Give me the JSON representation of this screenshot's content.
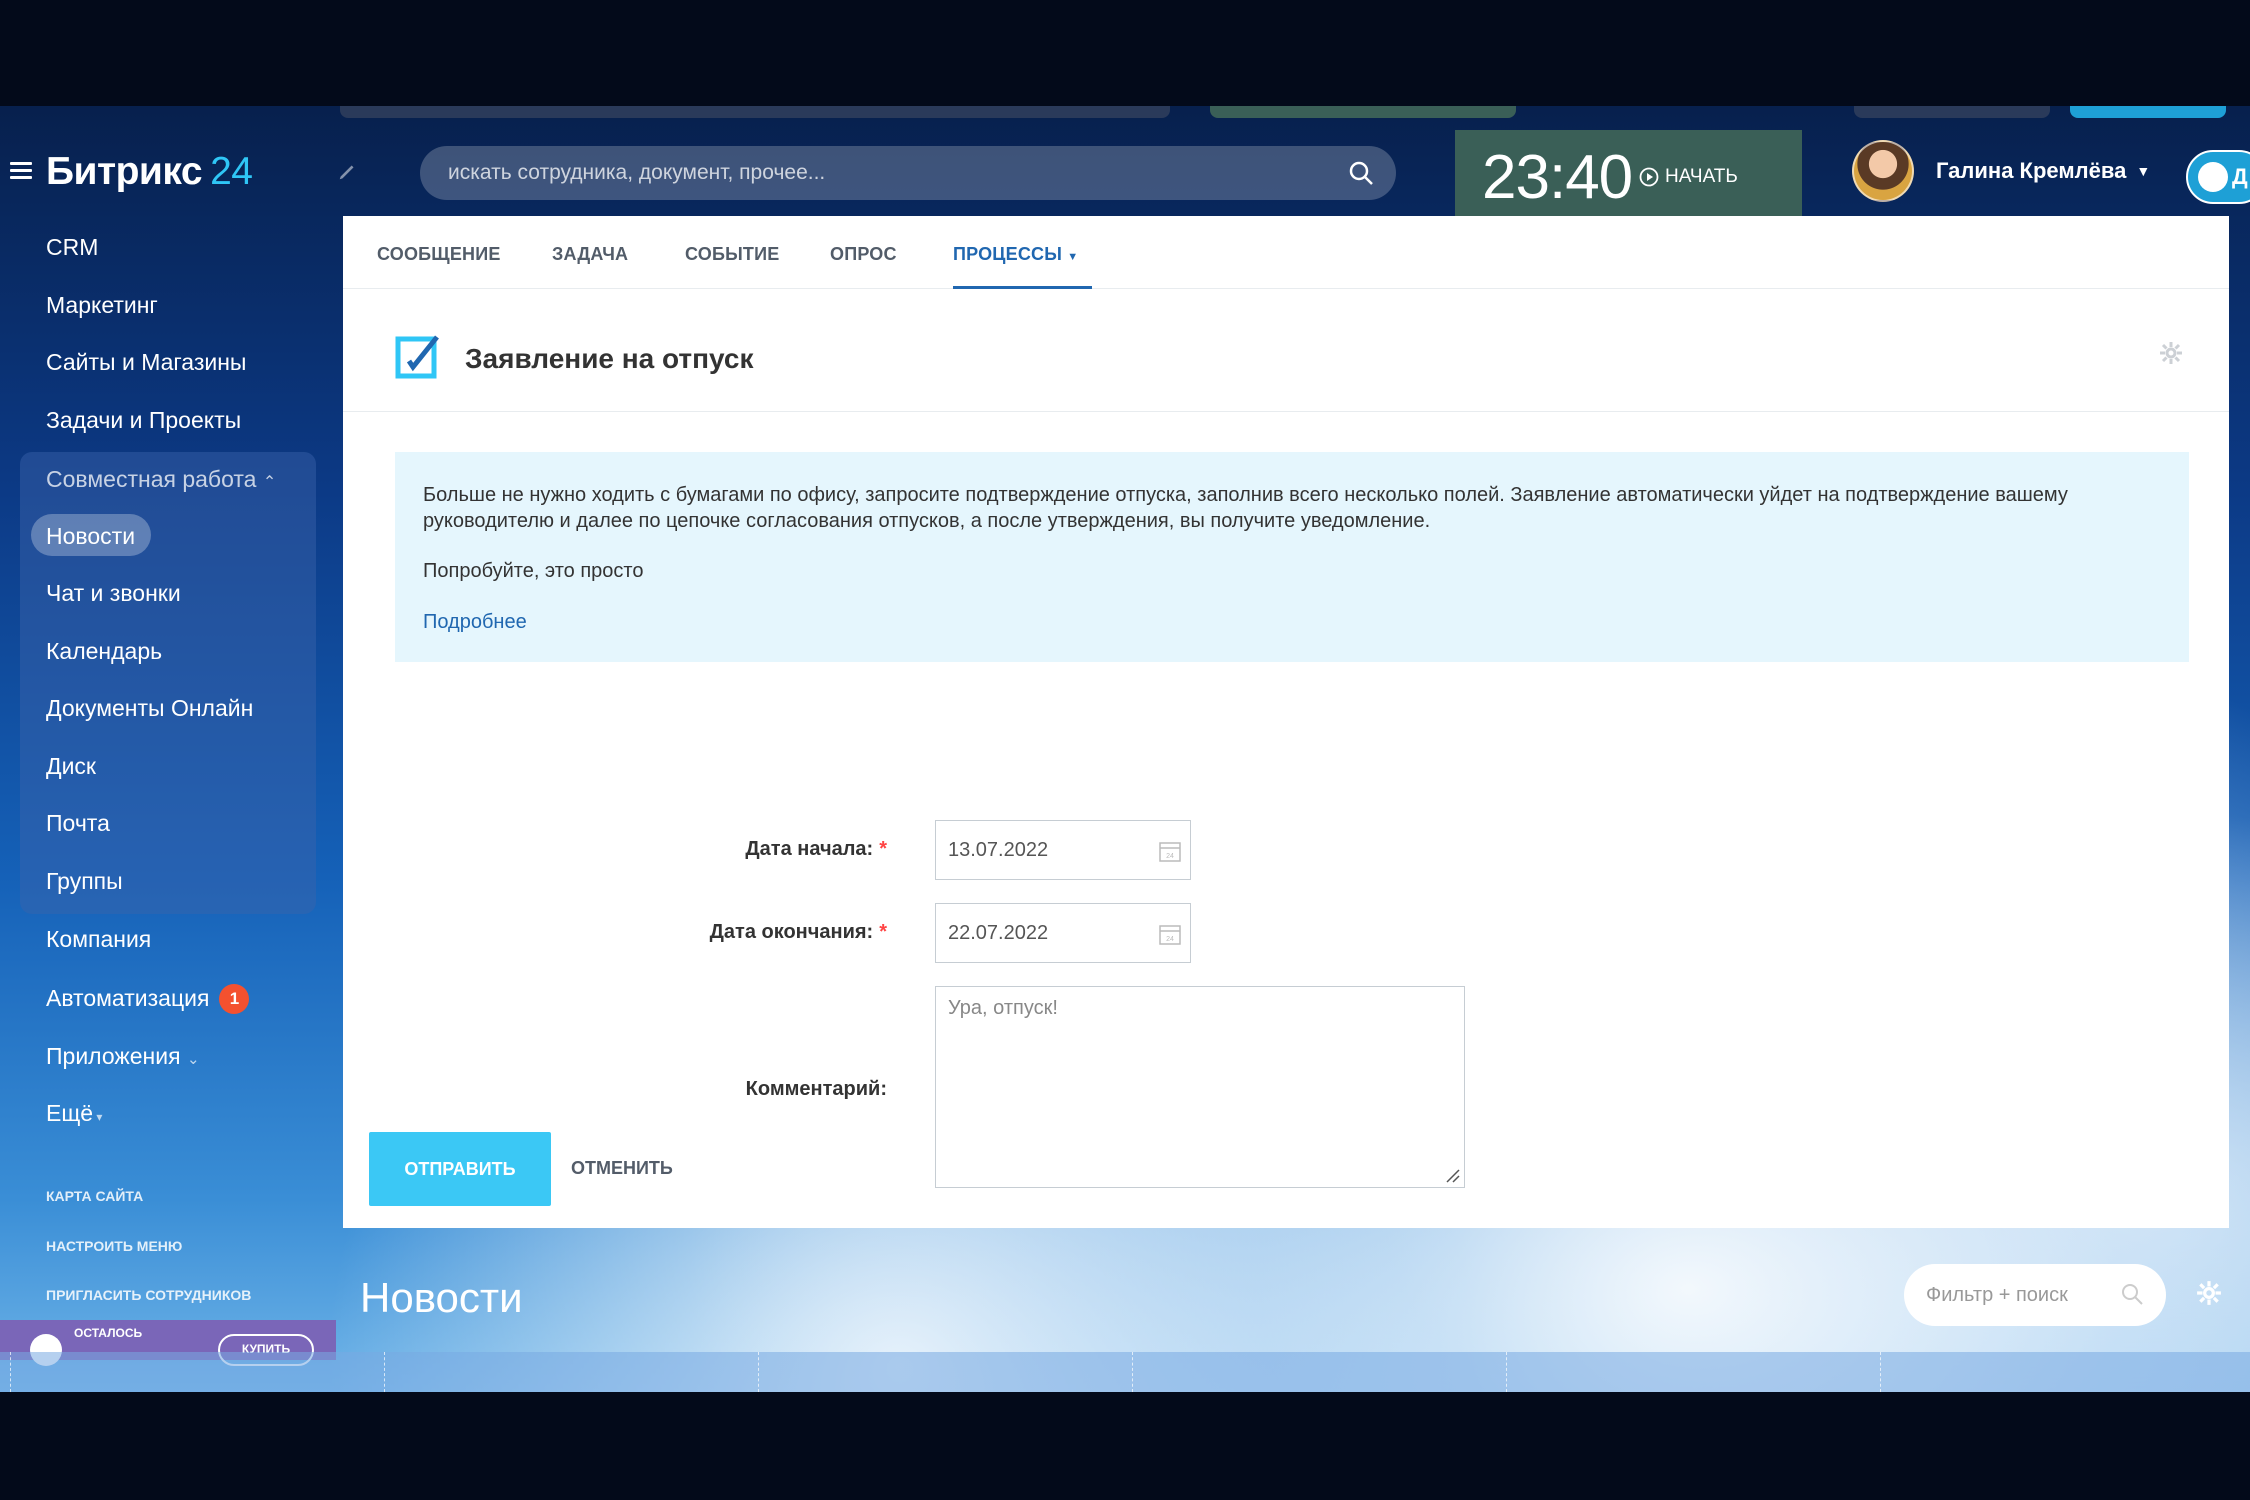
{
  "header": {
    "logo_text": "Битрикс",
    "logo_number": "24",
    "search_placeholder": "искать сотрудника, документ, прочее...",
    "clock_time": "23:40",
    "start_label": "НАЧАТЬ",
    "user_name": "Галина Кремлёва",
    "chat_label": "Д"
  },
  "sidebar": {
    "items": [
      "CRM",
      "Маркетинг",
      "Сайты и Магазины",
      "Задачи и Проекты"
    ],
    "group_title": "Совместная работа",
    "group_items": [
      "Новости",
      "Чат и звонки",
      "Календарь",
      "Документы Онлайн",
      "Диск",
      "Почта",
      "Группы"
    ],
    "after_items": [
      "Компания",
      "Автоматизация",
      "Приложения",
      "Ещё"
    ],
    "automation_badge": "1",
    "links": [
      "КАРТА САЙТА",
      "НАСТРОИТЬ МЕНЮ",
      "ПРИГЛАСИТЬ СОТРУДНИКОВ"
    ],
    "trial_label": "ОСТАЛОСЬ",
    "buy_label": "КУПИТЬ"
  },
  "tabs": [
    "СООБЩЕНИЕ",
    "ЗАДАЧА",
    "СОБЫТИЕ",
    "ОПРОС",
    "ПРОЦЕССЫ"
  ],
  "active_tab": "ПРОЦЕССЫ",
  "form": {
    "title": "Заявление на отпуск",
    "info_text": "Больше не нужно ходить с бумагами по офису, запросите подтверждение отпуска, заполнив всего несколько полей. Заявление автоматически уйдет на подтверждение вашему руководителю и далее по цепочке согласования отпусков, а после утверждения, вы получите уведомление.",
    "info_try": "Попробуйте, это просто",
    "info_more": "Подробнее",
    "start_label": "Дата начала:",
    "start_value": "13.07.2022",
    "end_label": "Дата окончания:",
    "end_value": "22.07.2022",
    "comment_label": "Комментарий:",
    "comment_value": "Ура, отпуск!",
    "submit_label": "ОТПРАВИТЬ",
    "cancel_label": "ОТМЕНИТЬ"
  },
  "page": {
    "title": "Новости",
    "filter_placeholder": "Фильтр + поиск"
  },
  "colors": {
    "accent": "#2067b0",
    "button": "#3bc8f5",
    "badge": "#f4512f",
    "clock_bg": "#3a5f57"
  }
}
